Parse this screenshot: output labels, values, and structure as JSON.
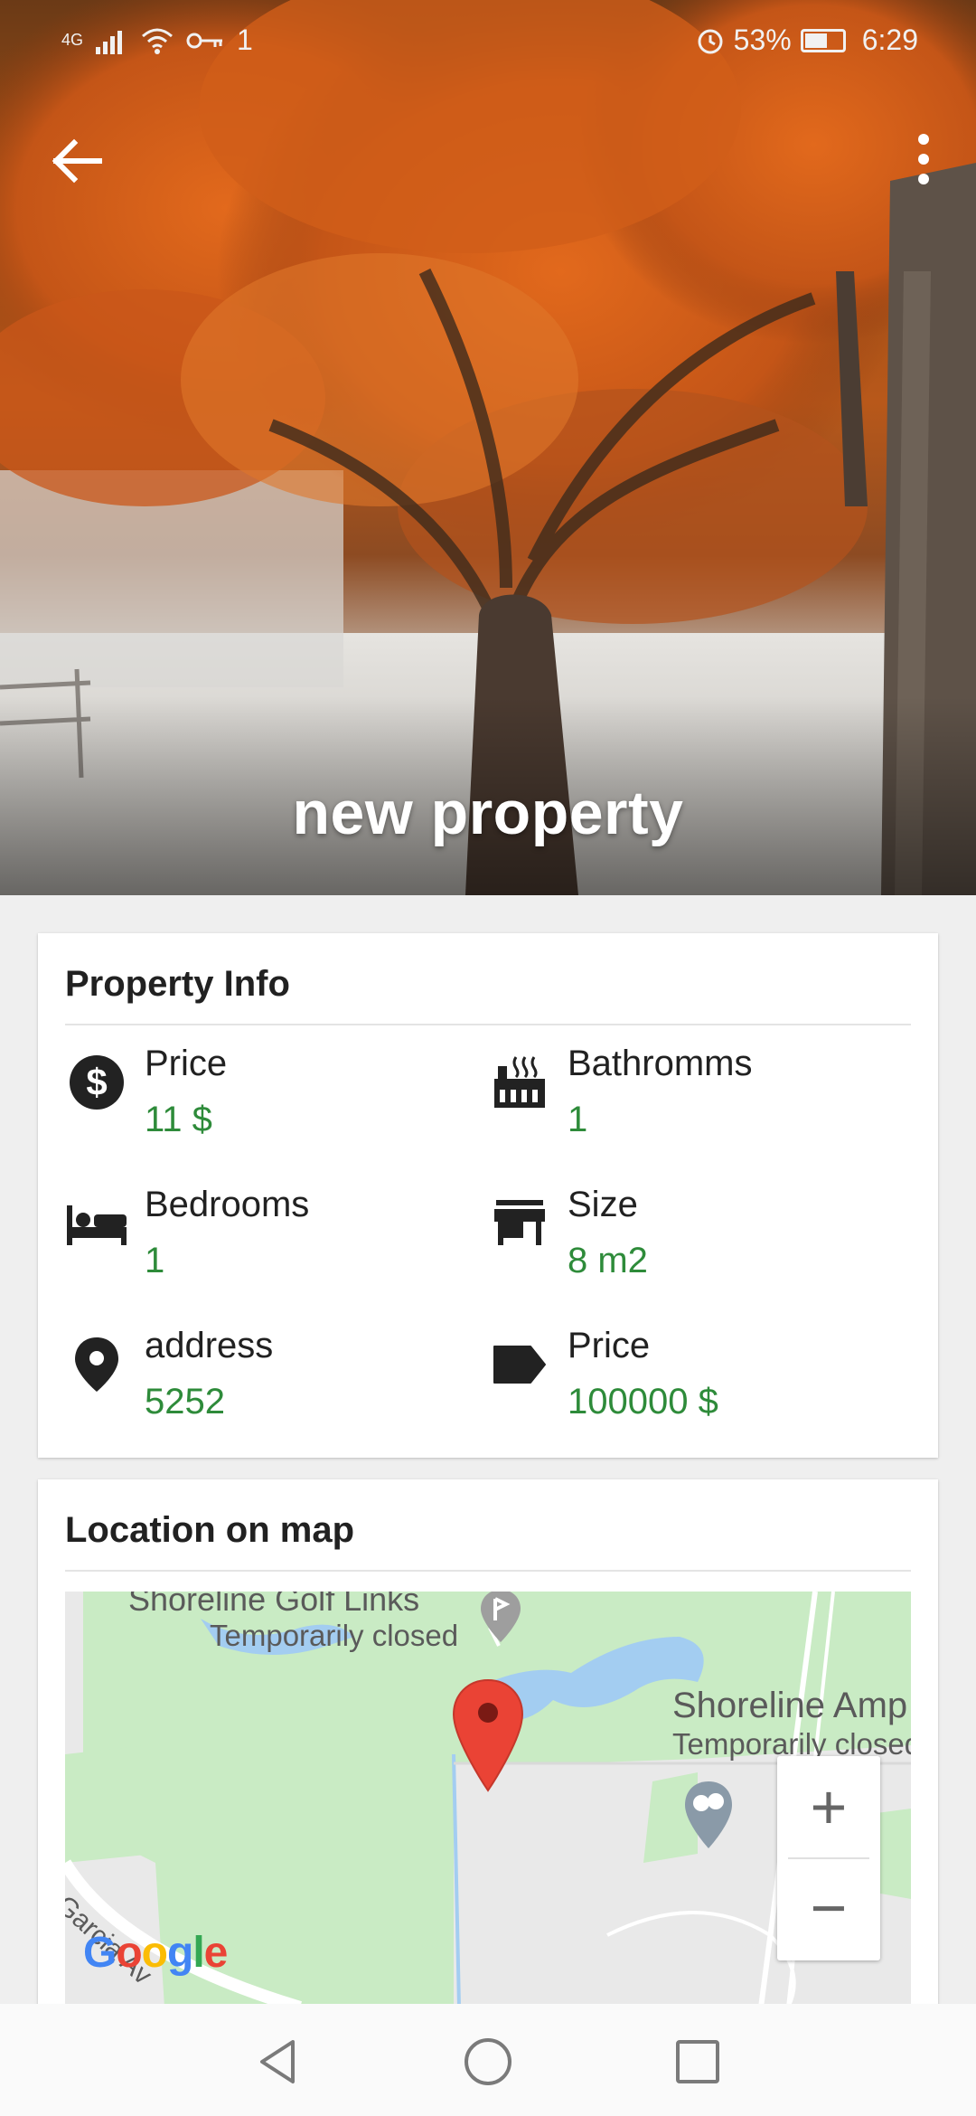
{
  "status_bar": {
    "network": "4G",
    "notification_count": "1",
    "battery": "53%",
    "time": "6:29"
  },
  "hero": {
    "title": "new property"
  },
  "property_info": {
    "title": "Property Info",
    "items": [
      {
        "label": "Price",
        "value": "11 $",
        "icon": "dollar-circle-icon"
      },
      {
        "label": "Bathromms",
        "value": "1",
        "icon": "bathtub-icon"
      },
      {
        "label": "Bedrooms",
        "value": "1",
        "icon": "bed-icon"
      },
      {
        "label": "Size",
        "value": "8 m2",
        "icon": "store-icon"
      },
      {
        "label": "address",
        "value": "5252",
        "icon": "location-pin-icon"
      },
      {
        "label": "Price",
        "value": "100000 $",
        "icon": "tag-icon"
      }
    ]
  },
  "map_section": {
    "title": "Location on map",
    "places": [
      {
        "name": "Shoreline Golf Links",
        "status": "Temporarily closed"
      },
      {
        "name": "Shoreline Amp",
        "status": "Temporarily closed"
      }
    ],
    "street": "Garcia Av",
    "zoom_in": "+",
    "zoom_out": "−",
    "attribution": "Google"
  },
  "colors": {
    "value_green": "#2e8b3a",
    "map_park": "#c9ebc4",
    "map_water": "#a3cdf1",
    "marker_red": "#ea4335"
  }
}
